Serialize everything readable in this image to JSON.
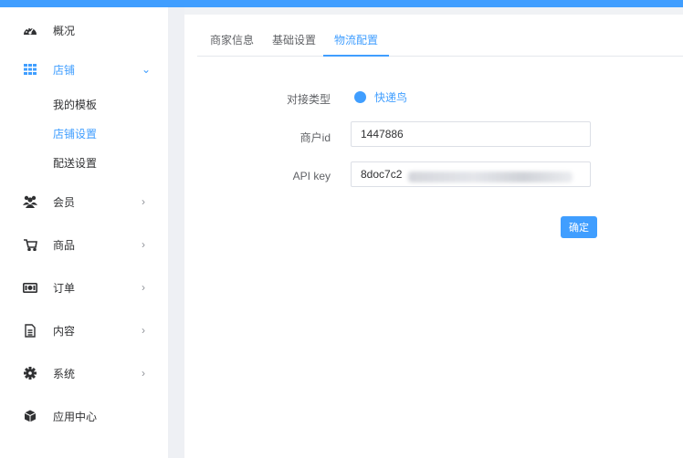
{
  "sidebar": {
    "items": [
      {
        "label": "概况",
        "icon": "dashboard-icon"
      },
      {
        "label": "店铺",
        "icon": "grid-icon",
        "arrow": "⌄"
      },
      {
        "label": "会员",
        "icon": "users-icon",
        "arrow": "›"
      },
      {
        "label": "商品",
        "icon": "cart-icon",
        "arrow": "›"
      },
      {
        "label": "订单",
        "icon": "money-icon",
        "arrow": "›"
      },
      {
        "label": "内容",
        "icon": "file-icon",
        "arrow": "›"
      },
      {
        "label": "系统",
        "icon": "gear-icon",
        "arrow": "›"
      },
      {
        "label": "应用中心",
        "icon": "cube-icon"
      }
    ],
    "sub_items": [
      {
        "label": "我的模板"
      },
      {
        "label": "店铺设置"
      },
      {
        "label": "配送设置"
      }
    ]
  },
  "tabs": [
    {
      "label": "商家信息"
    },
    {
      "label": "基础设置"
    },
    {
      "label": "物流配置"
    }
  ],
  "form": {
    "type_label": "对接类型",
    "type_value": "快递鸟",
    "merchant_label": "商户id",
    "merchant_value": "1447886",
    "apikey_label": "API key",
    "apikey_value": "8doc7c2"
  },
  "confirm_label": "确定",
  "colors": {
    "accent": "#409eff",
    "topbar": "#409eff"
  }
}
